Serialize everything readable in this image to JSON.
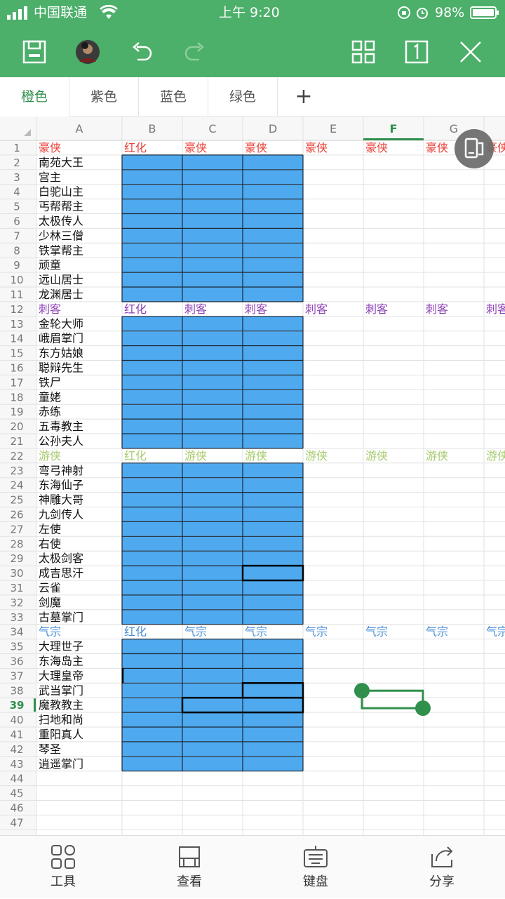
{
  "status": {
    "carrier": "中国联通",
    "time": "上午 9:20",
    "battery": "98%"
  },
  "tabs": [
    {
      "label": "橙色",
      "active": true
    },
    {
      "label": "紫色",
      "active": false
    },
    {
      "label": "蓝色",
      "active": false
    },
    {
      "label": "绿色",
      "active": false
    }
  ],
  "add_tab": "+",
  "columns": [
    "A",
    "B",
    "C",
    "D",
    "E",
    "F",
    "G"
  ],
  "active_column": "F",
  "active_row": 39,
  "row_numbers_max": 47,
  "colors": {
    "accent": "#4CAF6A",
    "fill": "#4FA9EE",
    "hao": "#E8433A",
    "ci": "#8A3FB5",
    "you": "#A8CB6E",
    "qi": "#4A8FD6"
  },
  "headers": [
    {
      "row": 1,
      "name": "豪侠",
      "b": "红化",
      "rest": "豪侠",
      "color": "hao"
    },
    {
      "row": 12,
      "name": "刺客",
      "b": "红化",
      "rest": "刺客",
      "color": "ci"
    },
    {
      "row": 22,
      "name": "游侠",
      "b": "红化",
      "rest": "游侠",
      "color": "you"
    },
    {
      "row": 34,
      "name": "气宗",
      "b": "红化",
      "rest": "气宗",
      "color": "qi"
    }
  ],
  "names": {
    "2": "南苑大王",
    "3": "宫主",
    "4": "白驼山主",
    "5": "丐帮帮主",
    "6": "太极传人",
    "7": "少林三僧",
    "8": "铁掌帮主",
    "9": "顽童",
    "10": "远山居士",
    "11": "龙渊居士",
    "13": "金轮大师",
    "14": "峨眉掌门",
    "15": "东方姑娘",
    "16": "聪辩先生",
    "17": "铁尸",
    "18": "童姥",
    "19": "赤练",
    "20": "五毒教主",
    "21": "公孙夫人",
    "23": "弯弓神射",
    "24": "东海仙子",
    "25": "神雕大哥",
    "26": "九剑传人",
    "27": "左使",
    "28": "右使",
    "29": "太极剑客",
    "30": "成吉思汗",
    "31": "云雀",
    "32": "剑魔",
    "33": "古墓掌门",
    "35": "大理世子",
    "36": "东海岛主",
    "37": "大理皇帝",
    "38": "武当掌门",
    "39": "魔教教主",
    "40": "扫地和尚",
    "41": "重阳真人",
    "42": "琴圣",
    "43": "逍遥掌门"
  },
  "bottom": [
    "工具",
    "查看",
    "键盘",
    "分享"
  ]
}
